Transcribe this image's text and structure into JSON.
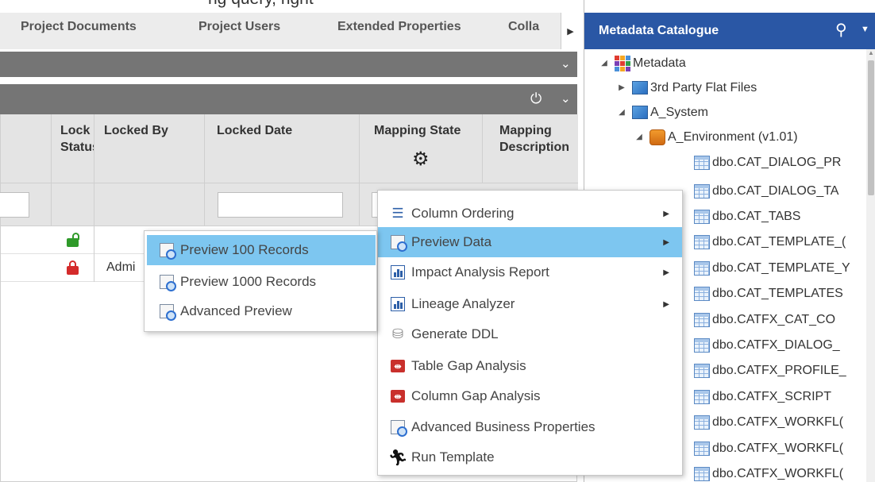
{
  "top_strip_text": "ng query, right",
  "tabs": [
    {
      "label": "Project Documents"
    },
    {
      "label": "Project Users"
    },
    {
      "label": "Extended Properties"
    },
    {
      "label": "Colla"
    }
  ],
  "grid": {
    "columns": [
      {
        "label": "Lock Status"
      },
      {
        "label": "Locked By"
      },
      {
        "label": "Locked Date"
      },
      {
        "label": "Mapping State"
      },
      {
        "label": "Mapping Description"
      }
    ],
    "rows": [
      {
        "lock": "unlocked",
        "locked_by": ""
      },
      {
        "lock": "locked",
        "locked_by": "Admi"
      }
    ]
  },
  "context_menu": {
    "items": [
      {
        "label": "Column Ordering",
        "icon": "list-icon",
        "submenu": true
      },
      {
        "label": "Preview Data",
        "icon": "preview-icon",
        "submenu": true,
        "selected": true
      },
      {
        "label": "Impact Analysis Report",
        "icon": "report-icon",
        "submenu": true
      },
      {
        "label": "Lineage Analyzer",
        "icon": "report-icon",
        "submenu": true
      },
      {
        "label": "Generate DDL",
        "icon": "ddl-icon",
        "submenu": false
      },
      {
        "label": "Table Gap Analysis",
        "icon": "gap-icon",
        "submenu": false
      },
      {
        "label": "Column Gap Analysis",
        "icon": "gap-icon",
        "submenu": false
      },
      {
        "label": "Advanced Business Properties",
        "icon": "preview-icon",
        "submenu": false
      },
      {
        "label": "Run Template",
        "icon": "run-icon",
        "submenu": false
      }
    ]
  },
  "preview_submenu": {
    "items": [
      {
        "label": "Preview 100 Records",
        "selected": true
      },
      {
        "label": "Preview 1000 Records"
      },
      {
        "label": "Advanced Preview"
      }
    ]
  },
  "metadata_catalogue": {
    "title": "Metadata Catalogue",
    "tree": [
      {
        "label": "Metadata"
      },
      {
        "label": "3rd Party Flat Files"
      },
      {
        "label": "A_System"
      },
      {
        "label": "A_Environment (v1.01)"
      },
      {
        "label": "dbo.CAT_DIALOG_PR"
      },
      {
        "label": "dbo.CAT_DIALOG_TA"
      },
      {
        "label": "dbo.CAT_TABS"
      },
      {
        "label": "dbo.CAT_TEMPLATE_("
      },
      {
        "label": "dbo.CAT_TEMPLATE_Y"
      },
      {
        "label": "dbo.CAT_TEMPLATES"
      },
      {
        "label": "dbo.CATFX_CAT_CO"
      },
      {
        "label": "dbo.CATFX_DIALOG_"
      },
      {
        "label": "dbo.CATFX_PROFILE_"
      },
      {
        "label": "dbo.CATFX_SCRIPT"
      },
      {
        "label": "dbo.CATFX_WORKFL("
      },
      {
        "label": "dbo.CATFX_WORKFL("
      },
      {
        "label": "dbo.CATFX_WORKFL("
      }
    ]
  }
}
